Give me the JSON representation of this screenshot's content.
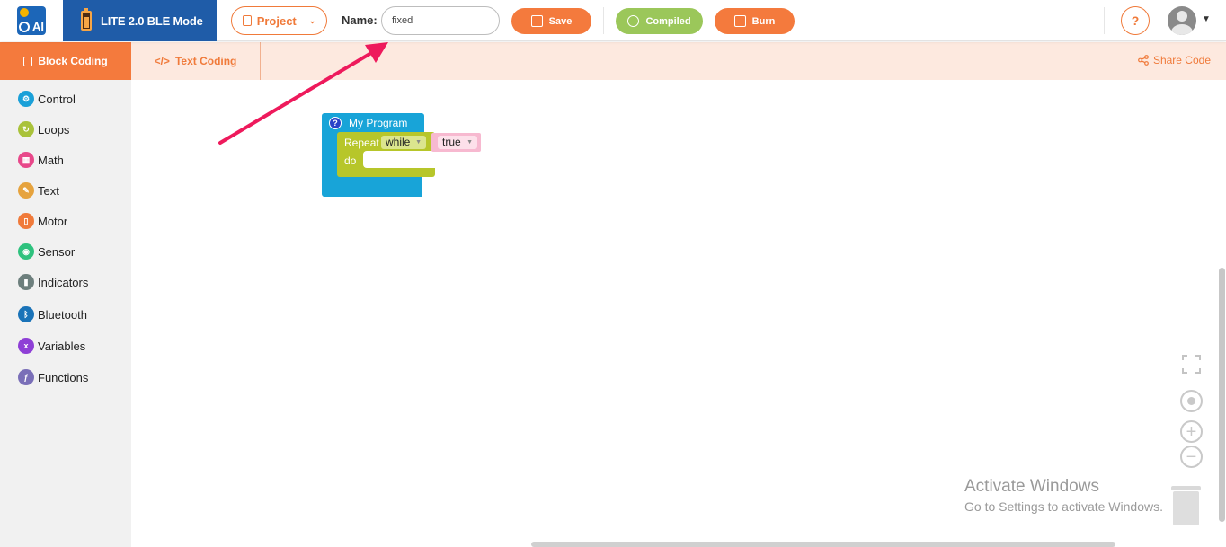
{
  "header": {
    "mode_label": "LITE 2.0 BLE Mode",
    "project_label": "Project",
    "name_label": "Name:",
    "name_value": "fixed",
    "save_label": "Save",
    "compiled_label": "Compiled",
    "burn_label": "Burn"
  },
  "tabs": {
    "block_coding": "Block Coding",
    "text_coding": "Text Coding",
    "share_code": "Share Code"
  },
  "sidebar": {
    "items": [
      {
        "label": "Control",
        "color": "#1aa0d8",
        "icon": "control-icon"
      },
      {
        "label": "Loops",
        "color": "#a9c23a",
        "icon": "loops-icon"
      },
      {
        "label": "Math",
        "color": "#e8488a",
        "icon": "math-icon"
      },
      {
        "label": "Text",
        "color": "#e6a33e",
        "icon": "text-icon"
      },
      {
        "label": "Motor",
        "color": "#f07a3a",
        "icon": "motor-icon"
      },
      {
        "label": "Sensor",
        "color": "#2ec27e",
        "icon": "sensor-icon"
      },
      {
        "label": "Indicators",
        "color": "#6d7f7d",
        "icon": "indicators-icon"
      },
      {
        "label": "Bluetooth",
        "color": "#1a73b8",
        "icon": "bluetooth-icon"
      },
      {
        "label": "Variables",
        "color": "#8e3fd6",
        "icon": "variables-icon"
      },
      {
        "label": "Functions",
        "color": "#7a6fb8",
        "icon": "functions-icon"
      }
    ]
  },
  "workspace": {
    "program_title": "My Program",
    "repeat_label": "Repeat",
    "while_value": "while",
    "true_value": "true",
    "do_label": "do"
  },
  "watermark": {
    "title": "Activate Windows",
    "subtitle": "Go to Settings to activate Windows."
  },
  "colors": {
    "accent": "#f47a3d",
    "mode_bg": "#1f5ca8",
    "compiled": "#9bc75a",
    "arrow": "#ee1a5c"
  }
}
